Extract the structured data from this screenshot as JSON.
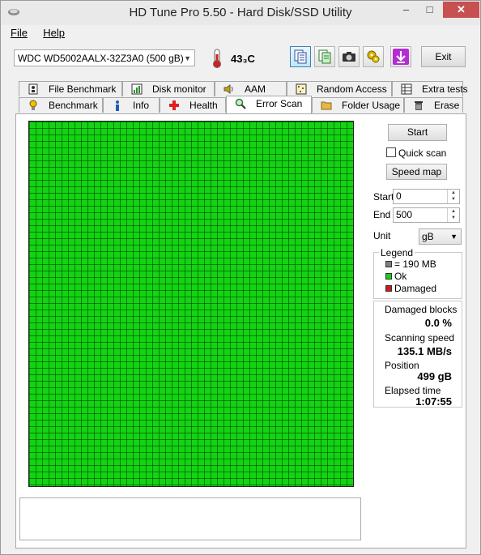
{
  "window": {
    "title": "HD Tune Pro 5.50 - Hard Disk/SSD Utility",
    "minimize": "–",
    "maximize": "□",
    "close": "✕"
  },
  "menu": {
    "file": "File",
    "help": "Help"
  },
  "toolbar": {
    "drive": "WDC WD5002AALX-32Z3A0 (500 gB)",
    "temperature": "43₃C",
    "exit": "Exit",
    "icons": [
      "copy-text-icon",
      "copy-info-icon",
      "screenshot-icon",
      "options-icon",
      "save-icon"
    ]
  },
  "tabs_top": [
    {
      "label": "File Benchmark",
      "icon": "file-benchmark-icon"
    },
    {
      "label": "Disk monitor",
      "icon": "disk-monitor-icon"
    },
    {
      "label": "AAM",
      "icon": "speaker-icon"
    },
    {
      "label": "Random Access",
      "icon": "random-access-icon"
    },
    {
      "label": "Extra tests",
      "icon": "extra-tests-icon"
    }
  ],
  "tabs_bottom": [
    {
      "label": "Benchmark",
      "icon": "benchmark-icon"
    },
    {
      "label": "Info",
      "icon": "info-icon"
    },
    {
      "label": "Health",
      "icon": "health-cross-icon"
    },
    {
      "label": "Error Scan",
      "icon": "magnifier-icon",
      "selected": true
    },
    {
      "label": "Folder Usage",
      "icon": "folder-icon"
    },
    {
      "label": "Erase",
      "icon": "trash-icon"
    }
  ],
  "scan": {
    "start_button": "Start",
    "quick_scan": "Quick scan",
    "quick_scan_checked": false,
    "speed_map_button": "Speed map",
    "start_label": "Start",
    "start_value": "0",
    "end_label": "End",
    "end_value": "500",
    "unit_label": "Unit",
    "unit_value": "gB"
  },
  "legend": {
    "title": "Legend",
    "block": "= 190 MB",
    "ok": "Ok",
    "damaged": "Damaged",
    "colors": {
      "block": "#808080",
      "ok": "#13d313",
      "damaged": "#d41a1a"
    }
  },
  "stats": {
    "damaged_label": "Damaged blocks",
    "damaged_value": "0.0 %",
    "speed_label": "Scanning speed",
    "speed_value": "135.1 MB/s",
    "position_label": "Position",
    "position_value": "499 gB",
    "elapsed_label": "Elapsed time",
    "elapsed_value": "1:07:55"
  },
  "grid": {
    "color": "#13d313",
    "status": "all blocks ok"
  }
}
